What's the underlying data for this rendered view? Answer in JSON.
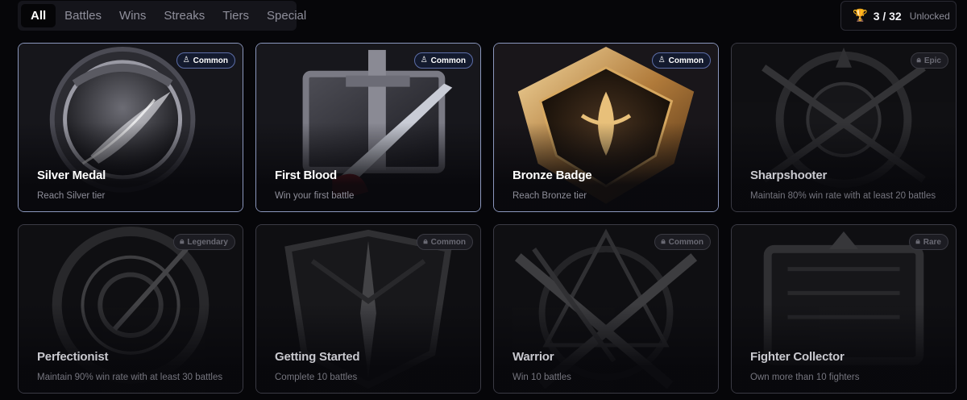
{
  "tabs": [
    {
      "label": "All",
      "active": true
    },
    {
      "label": "Battles",
      "active": false
    },
    {
      "label": "Wins",
      "active": false
    },
    {
      "label": "Streaks",
      "active": false
    },
    {
      "label": "Tiers",
      "active": false
    },
    {
      "label": "Special",
      "active": false
    }
  ],
  "counter": {
    "icon": "trophy-icon",
    "value": "3 / 32",
    "label": "Unlocked",
    "color": "#f2a51a"
  },
  "achievements": [
    {
      "title": "Silver Medal",
      "description": "Reach Silver tier",
      "rarity": "Common",
      "unlocked": true,
      "art": "silver-medal-art"
    },
    {
      "title": "First Blood",
      "description": "Win your first battle",
      "rarity": "Common",
      "unlocked": true,
      "art": "first-blood-art"
    },
    {
      "title": "Bronze Badge",
      "description": "Reach Bronze tier",
      "rarity": "Common",
      "unlocked": true,
      "art": "bronze-badge-art"
    },
    {
      "title": "Sharpshooter",
      "description": "Maintain 80% win rate with at least 20 battles",
      "rarity": "Epic",
      "unlocked": false,
      "art": "sharpshooter-art"
    },
    {
      "title": "Perfectionist",
      "description": "Maintain 90% win rate with at least 30 battles",
      "rarity": "Legendary",
      "unlocked": false,
      "art": "perfectionist-art"
    },
    {
      "title": "Getting Started",
      "description": "Complete 10 battles",
      "rarity": "Common",
      "unlocked": false,
      "art": "getting-started-art"
    },
    {
      "title": "Warrior",
      "description": "Win 10 battles",
      "rarity": "Common",
      "unlocked": false,
      "art": "warrior-art"
    },
    {
      "title": "Fighter Collector",
      "description": "Own more than 10 fighters",
      "rarity": "Rare",
      "unlocked": false,
      "art": "fighter-collector-art"
    }
  ]
}
